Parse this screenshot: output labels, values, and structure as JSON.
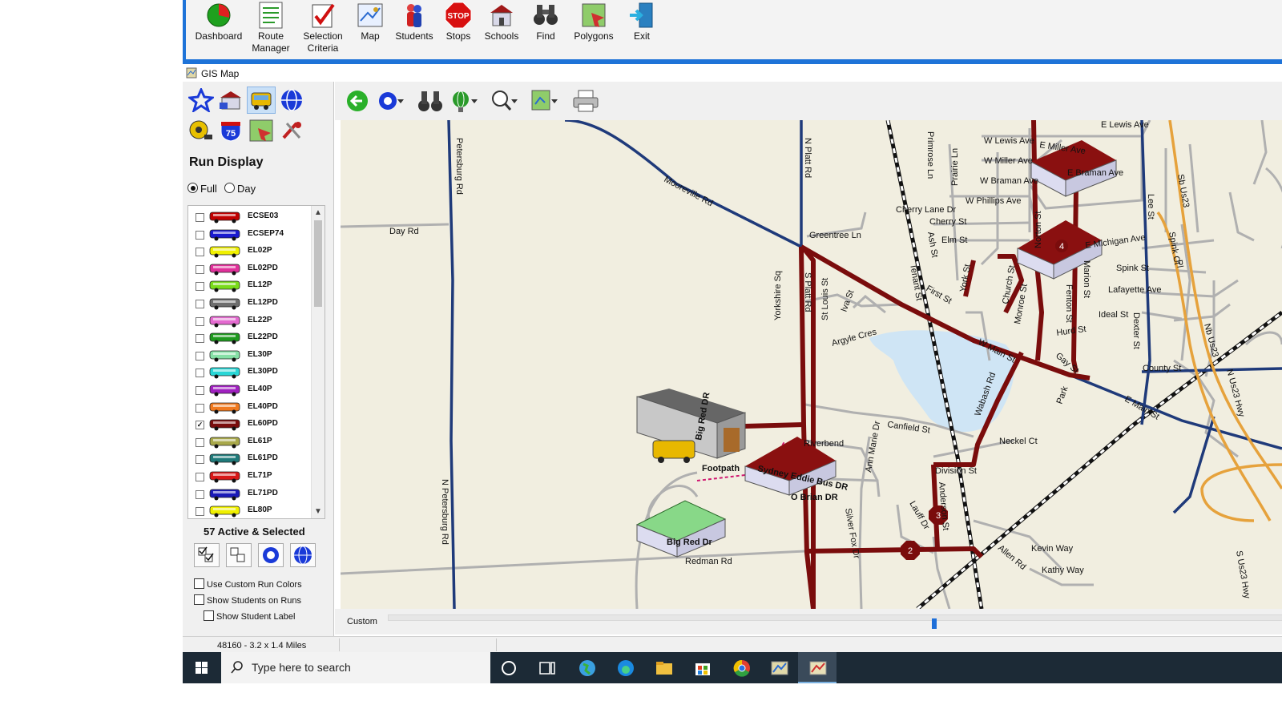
{
  "app_toolbar": {
    "buttons": [
      {
        "id": "dashboard",
        "label": "Dashboard",
        "icon": "dashboard-icon"
      },
      {
        "id": "route-manager",
        "label": "Route\nManager",
        "icon": "route-manager-icon"
      },
      {
        "id": "selection-criteria",
        "label": "Selection\nCriteria",
        "icon": "selection-criteria-icon"
      },
      {
        "id": "map",
        "label": "Map",
        "icon": "map-icon"
      },
      {
        "id": "students",
        "label": "Students",
        "icon": "students-icon"
      },
      {
        "id": "stops",
        "label": "Stops",
        "icon": "stop-sign-icon"
      },
      {
        "id": "schools",
        "label": "Schools",
        "icon": "schools-icon"
      },
      {
        "id": "find",
        "label": "Find",
        "icon": "binoculars-icon"
      },
      {
        "id": "polygons",
        "label": "Polygons",
        "icon": "polygons-icon"
      },
      {
        "id": "exit",
        "label": "Exit",
        "icon": "exit-icon"
      }
    ],
    "stop_icon_text": "STOP"
  },
  "window": {
    "title": "GIS Map"
  },
  "left_panel": {
    "title": "Run Display",
    "radio_full": "Full",
    "radio_day": "Day",
    "selected_radio": "Full",
    "runs": [
      {
        "name": "ECSE03",
        "color": "#c00000",
        "checked": false
      },
      {
        "name": "ECSEP74",
        "color": "#1a1ad0",
        "checked": false
      },
      {
        "name": "EL02P",
        "color": "#f0f000",
        "checked": false
      },
      {
        "name": "EL02PD",
        "color": "#e0309a",
        "checked": false
      },
      {
        "name": "EL12P",
        "color": "#7adc1a",
        "checked": false
      },
      {
        "name": "EL12PD",
        "color": "#6e6e6e",
        "checked": false
      },
      {
        "name": "EL22P",
        "color": "#e46ad0",
        "checked": false
      },
      {
        "name": "EL22PD",
        "color": "#1f9a1f",
        "checked": false
      },
      {
        "name": "EL30P",
        "color": "#86e0a6",
        "checked": false
      },
      {
        "name": "EL30PD",
        "color": "#28d6d6",
        "checked": false
      },
      {
        "name": "EL40P",
        "color": "#a020c0",
        "checked": false
      },
      {
        "name": "EL40PD",
        "color": "#f07a20",
        "checked": false
      },
      {
        "name": "EL60PD",
        "color": "#7a0c0c",
        "checked": true
      },
      {
        "name": "EL61P",
        "color": "#a8a84a",
        "checked": false
      },
      {
        "name": "EL61PD",
        "color": "#1f7a7a",
        "checked": false
      },
      {
        "name": "EL71P",
        "color": "#d81818",
        "checked": false
      },
      {
        "name": "EL71PD",
        "color": "#1a1ab8",
        "checked": false
      },
      {
        "name": "EL80P",
        "color": "#f0f000",
        "checked": false
      }
    ],
    "active_count": "57 Active & Selected",
    "options": {
      "custom_colors": "Use Custom Run Colors",
      "show_students": "Show Students on Runs",
      "show_label": "Show Student Label"
    }
  },
  "map": {
    "roads": {
      "petersburg": "Petersburg Rd",
      "n_petersburg": "N Petersburg Rd",
      "day": "Day Rd",
      "mooreville": "Mooreville Rd",
      "n_platt": "N Platt Rd",
      "s_platt": "S Platt Rd",
      "greentree": "Greentree Ln",
      "yorkshire": "Yorkshire Sq",
      "st_louis": "St Louis St",
      "iva": "Iva St",
      "argyle": "Argyle Cres",
      "canfield": "Canfield St",
      "riverbend": "Riverbend",
      "ann_marie": "Ann Marie Dr",
      "sydney_eddie": "Sydney Eddie Bus DR",
      "o_brian": "O Brian DR",
      "footpath": "Footpath",
      "big_red_dr_top": "Big Red DR",
      "big_red_dr": "Big Red Dr",
      "redman": "Redman Rd",
      "silver_fox": "Silver Fox Dr",
      "lauff": "Lauff Dr",
      "anderson": "Anderson St",
      "division": "Division St",
      "neckel": "Neckel Ct",
      "wabash": "Wabash Rd",
      "allen": "Allen Rd",
      "kevin": "Kevin Way",
      "kathy": "Kathy Way",
      "primrose": "Primrose Ln",
      "prairie": "Prairie Ln",
      "w_lewis": "W Lewis Ave",
      "e_lewis": "E Lewis Ave",
      "w_miller": "W Miller Ave",
      "e_miller": "E Miller Ave",
      "w_braman": "W Braman Ave",
      "e_braman": "E Braman Ave",
      "w_phillips": "W Phillips Ave",
      "cherry_lane": "Cherry Lane Dr",
      "cherry_st": "Cherry St",
      "elm": "Elm St",
      "ash": "Ash St",
      "tenant": "Tenant St",
      "first": "First St",
      "york": "York St",
      "church": "Church St",
      "e_michigan": "E Michigan Ave",
      "lee": "Lee St",
      "spink_st": "Spink St",
      "lafayette": "Lafayette Ave",
      "ideal": "Ideal St",
      "hurd": "Hurd St",
      "w_main": "W Main St",
      "e_main": "E Main St",
      "gay": "Gay St",
      "park": "Park",
      "county": "County St",
      "dexter": "Dexter St",
      "spink_ct": "Spink Ct",
      "n_us23": "N Us23 Hwy",
      "nb_us23": "Nb Us23",
      "sb_us23": "Sb Us23",
      "s_us23": "S Us23 Hwy",
      "monroe": "Monroe St",
      "norton": "Norton St",
      "marion": "Marion St",
      "fenton": "Fenton St",
      "pl": "Pl"
    },
    "stop_markers": [
      {
        "label": "2"
      },
      {
        "label": "3"
      },
      {
        "label": "4"
      }
    ]
  },
  "slider": {
    "label": "Custom",
    "position": 0.61
  },
  "status_bar": {
    "scale": "48160 - 3.2 x 1.4 Miles"
  },
  "taskbar": {
    "search_placeholder": "Type here to search"
  }
}
